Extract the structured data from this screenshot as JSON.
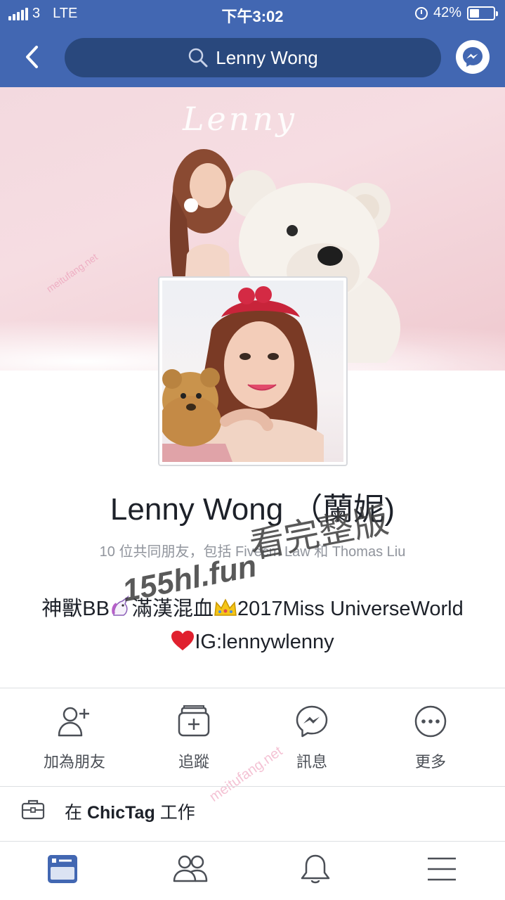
{
  "status_bar": {
    "carrier": "3",
    "network": "LTE",
    "time": "下午3:02",
    "battery_percent": "42%",
    "battery_level": 0.42
  },
  "nav": {
    "search_text": "Lenny Wong",
    "back_icon": "chevron-left-icon",
    "messenger_icon": "messenger-icon"
  },
  "cover": {
    "signature": "Lenny"
  },
  "profile": {
    "name": "Lenny Wong （蘭妮)",
    "mutual_friends": "10 位共同朋友，包括 Fivecm Law 和 Thomas Liu",
    "bio_line1_a": "神獸BB",
    "bio_line1_b": "滿漢混血",
    "bio_line1_c": "2017Miss UniverseWorld",
    "bio_line2": "IG:lennywlenny"
  },
  "watermark": {
    "host": "155hl.fun",
    "text": "看完整版",
    "faint": "meitufang.net"
  },
  "actions": [
    {
      "label": "加為朋友",
      "icon": "add-friend-icon"
    },
    {
      "label": "追蹤",
      "icon": "follow-icon"
    },
    {
      "label": "訊息",
      "icon": "messenger-icon"
    },
    {
      "label": "更多",
      "icon": "more-icon"
    }
  ],
  "work": {
    "prefix": "在",
    "company": "ChicTag",
    "suffix": "工作"
  },
  "tabbar": [
    {
      "icon": "news-feed-icon",
      "active": true
    },
    {
      "icon": "friends-icon",
      "active": false
    },
    {
      "icon": "notifications-icon",
      "active": false
    },
    {
      "icon": "menu-icon",
      "active": false
    }
  ],
  "colors": {
    "brand": "#4267b2",
    "search_bg": "#29487d",
    "text_primary": "#1d2129",
    "text_secondary": "#90949c"
  }
}
